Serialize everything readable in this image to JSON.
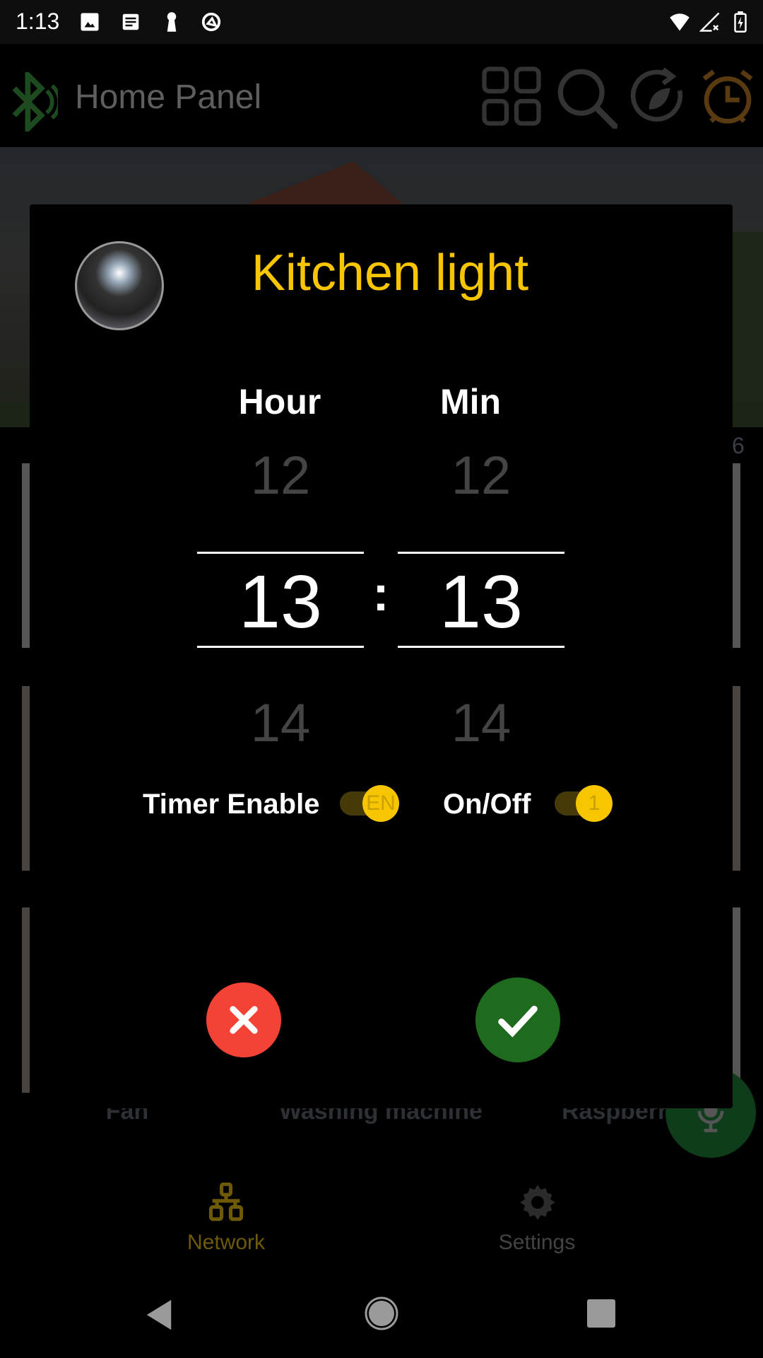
{
  "status_bar": {
    "time": "1:13",
    "icons": [
      "image-icon",
      "news-icon",
      "keyhole-icon",
      "sync-disabled-icon",
      "wifi-icon",
      "no-signal-icon",
      "battery-charging-icon"
    ]
  },
  "app_bar": {
    "title": "Home Panel",
    "icons": [
      "bluetooth-icon",
      "grid-icon",
      "search-icon",
      "eco-refresh-icon",
      "alarm-icon"
    ],
    "alarm_color": "#5a3a10"
  },
  "dialog": {
    "title": "Kitchen light",
    "title_color": "#f7c600",
    "hour_label": "Hour",
    "min_label": "Min",
    "hour": {
      "prev": "12",
      "selected": "13",
      "next": "14"
    },
    "min": {
      "prev": "12",
      "selected": "13",
      "next": "14"
    },
    "separator": ":",
    "timer_enable": {
      "label": "Timer Enable",
      "thumb_text": "EN",
      "on": true
    },
    "on_off": {
      "label": "On/Off",
      "thumb_text": "1",
      "on": true
    },
    "cancel_color": "#f44336",
    "confirm_color": "#1e6a1e"
  },
  "background": {
    "partial_count": "6",
    "device_labels": [
      "Fan",
      "Washing machine",
      "Raspberr"
    ]
  },
  "bottom_nav": {
    "items": [
      {
        "label": "Network",
        "active": true
      },
      {
        "label": "Settings",
        "active": false
      }
    ],
    "active_color": "#6e5a08"
  }
}
